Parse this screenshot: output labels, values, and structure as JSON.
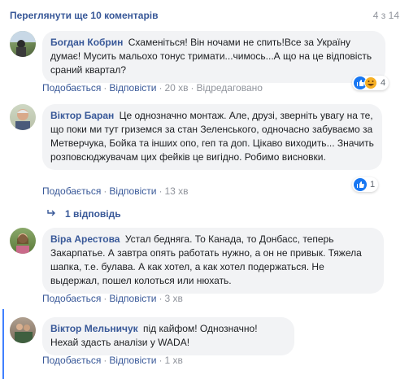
{
  "header": {
    "view_more": "Переглянути ще 10 коментарів",
    "page_count": "4 з 14"
  },
  "comments": [
    {
      "author": "Богдан Кобрин",
      "text": "Схаменіться! Він ночами не спить!Все за Україну думає! Мусить мальохо тонус тримати...чимось...А що на це відповість сраний квартал?",
      "like": "Подобається",
      "reply": "Відповісти",
      "time": "20 хв",
      "edited": "Відредаговано",
      "reaction_count": "4"
    },
    {
      "author": "Віктор Баран",
      "text": "Це однозначно монтаж. Але, друзі, зверніть увагу на те, що поки ми тут гриземся за стан Зеленського, одночасно забуваємо за Метверчука, Бойка та інших опо, геп та доп. Цікаво виходить... Значить розповсюджувачам цих фейків це вигідно. Робимо висновки.",
      "like": "Подобається",
      "reply": "Відповісти",
      "time": "13 хв",
      "reaction_count": "1",
      "replies_link": "1 відповідь"
    },
    {
      "author": "Віра Арестова",
      "text": "Устал бедняга. То Канада, то Донбасс, теперь Закарпатье. А завтра опять работать нужно, а он не привык. Тяжела шапка, т.е. булава. А как хотел, а как хотел подержаться. Не выдержал, пошел колоться или нюхать.",
      "like": "Подобається",
      "reply": "Відповісти",
      "time": "3 хв"
    },
    {
      "author": "Віктор Мельничук",
      "text": "під кайфом! Однозначно! Нехай здасть аналізи у WADA!",
      "like": "Подобається",
      "reply": "Відповісти",
      "time": "1 хв"
    }
  ],
  "colors": {
    "link": "#385898",
    "bubble": "#f2f3f5",
    "meta": "#90949c",
    "like_blue": "#1877f2",
    "haha_yellow": "#f7b125",
    "focus_rail": "#4080ff"
  }
}
